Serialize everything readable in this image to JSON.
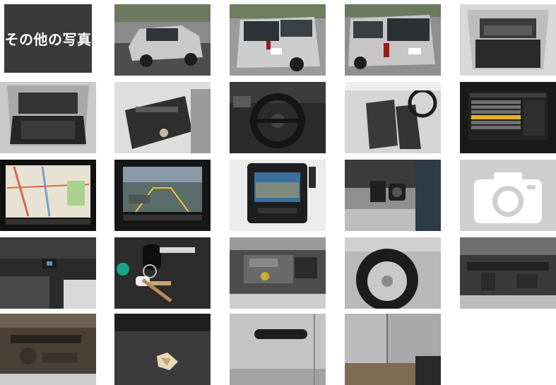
{
  "gallery": {
    "header_tile": {
      "label": "その他の写真"
    },
    "photos": [
      {
        "subject": "car-front-three-quarter"
      },
      {
        "subject": "car-rear"
      },
      {
        "subject": "car-rear-three-quarter"
      },
      {
        "subject": "cargo-area-open"
      },
      {
        "subject": "cargo-area-interior"
      },
      {
        "subject": "rear-seat"
      },
      {
        "subject": "steering-wheel-dashboard"
      },
      {
        "subject": "front-seats"
      },
      {
        "subject": "navigation-menu-screen"
      },
      {
        "subject": "navigation-map-screen"
      },
      {
        "subject": "rear-camera-screen"
      },
      {
        "subject": "dash-camera"
      },
      {
        "subject": "power-outlet"
      },
      {
        "subject": "no-image-placeholder",
        "icon": "camera-icon"
      },
      {
        "subject": "under-dash"
      },
      {
        "subject": "car-keys"
      },
      {
        "subject": "engine-bay"
      },
      {
        "subject": "wheel-tire"
      },
      {
        "subject": "undercarriage-front"
      },
      {
        "subject": "undercarriage-rear"
      },
      {
        "subject": "seat-damage"
      },
      {
        "subject": "door-handle"
      },
      {
        "subject": "door-panel-damage"
      }
    ]
  }
}
